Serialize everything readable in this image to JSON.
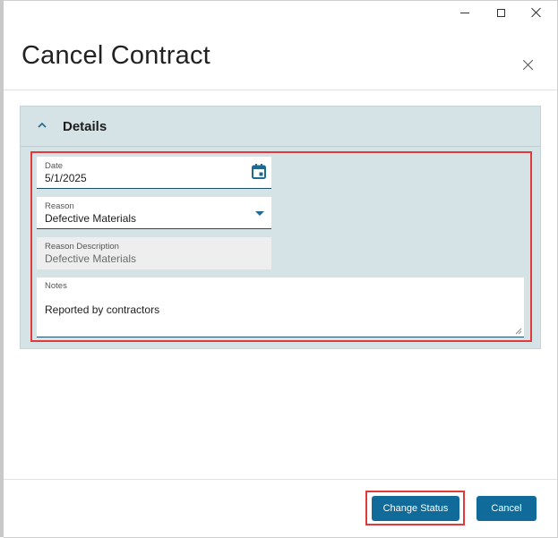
{
  "window": {
    "controls": [
      "minimize-icon",
      "maximize-icon",
      "close-icon"
    ]
  },
  "dialog": {
    "title": "Cancel Contract",
    "close_icon": "close-icon"
  },
  "details": {
    "header": "Details",
    "expanded": true,
    "fields": {
      "date": {
        "label": "Date",
        "value": "5/1/2025",
        "icon": "calendar-icon"
      },
      "reason": {
        "label": "Reason",
        "value": "Defective Materials",
        "icon": "caret-down-icon"
      },
      "reason_description": {
        "label": "Reason Description",
        "value": "Defective Materials",
        "read_only": true
      },
      "notes": {
        "label": "Notes",
        "value": "Reported by contractors"
      }
    }
  },
  "footer": {
    "change_status_label": "Change Status",
    "cancel_label": "Cancel"
  },
  "colors": {
    "primary_button": "#106a9a",
    "section_background": "#d5e2e6",
    "highlight": "#e23a3a"
  }
}
